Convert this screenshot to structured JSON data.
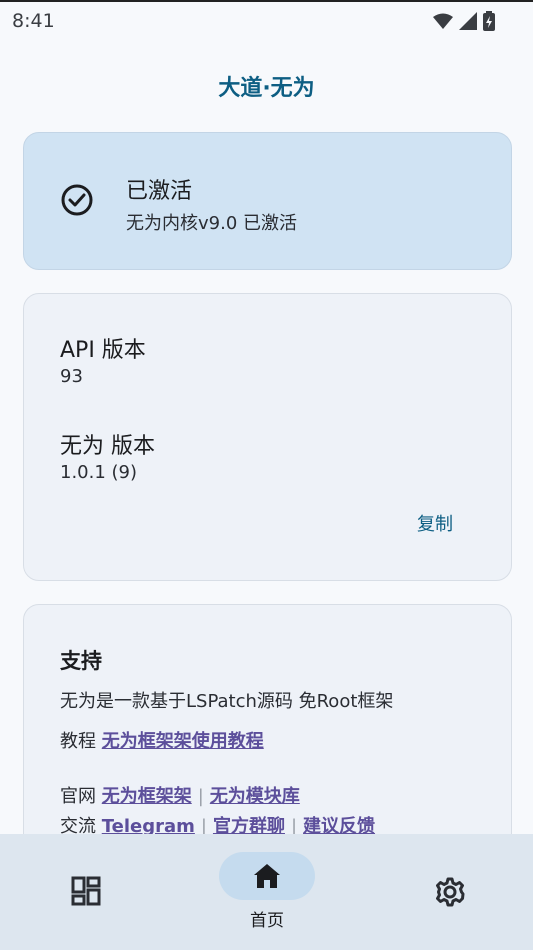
{
  "status_bar": {
    "time": "8:41",
    "icons": [
      "wifi-icon",
      "signal-icon",
      "battery-charging-icon"
    ]
  },
  "app": {
    "title": "大道·无为"
  },
  "status_card": {
    "icon": "check-circle-icon",
    "title": "已激活",
    "subtitle": "无为内核v9.0 已激活",
    "bg_color": "#d0e3f3"
  },
  "info_card": {
    "api_label": "API 版本",
    "api_value": "93",
    "version_label": "无为 版本",
    "version_value": "1.0.1 (9)",
    "copy_label": "复制"
  },
  "support_card": {
    "title": "支持",
    "description": "无为是一款基于LSPatch源码 免Root框架",
    "tutorial_prefix": "教程",
    "tutorial_link": "无为框架架使用教程",
    "website_prefix": "官网",
    "website_links": [
      "无为框架架",
      "无为模块库"
    ],
    "community_prefix": "交流",
    "community_links": [
      "Telegram",
      "官方群聊",
      "建议反馈"
    ]
  },
  "bottom_nav": {
    "items": [
      {
        "icon": "dashboard-icon",
        "label": ""
      },
      {
        "icon": "home-icon",
        "label": "首页",
        "selected": true
      },
      {
        "icon": "gear-icon",
        "label": ""
      }
    ]
  },
  "colors": {
    "accent": "#0d5e83",
    "link": "#5c4f9b",
    "background": "#f7f9fc",
    "nav_background": "#dde6ef"
  }
}
